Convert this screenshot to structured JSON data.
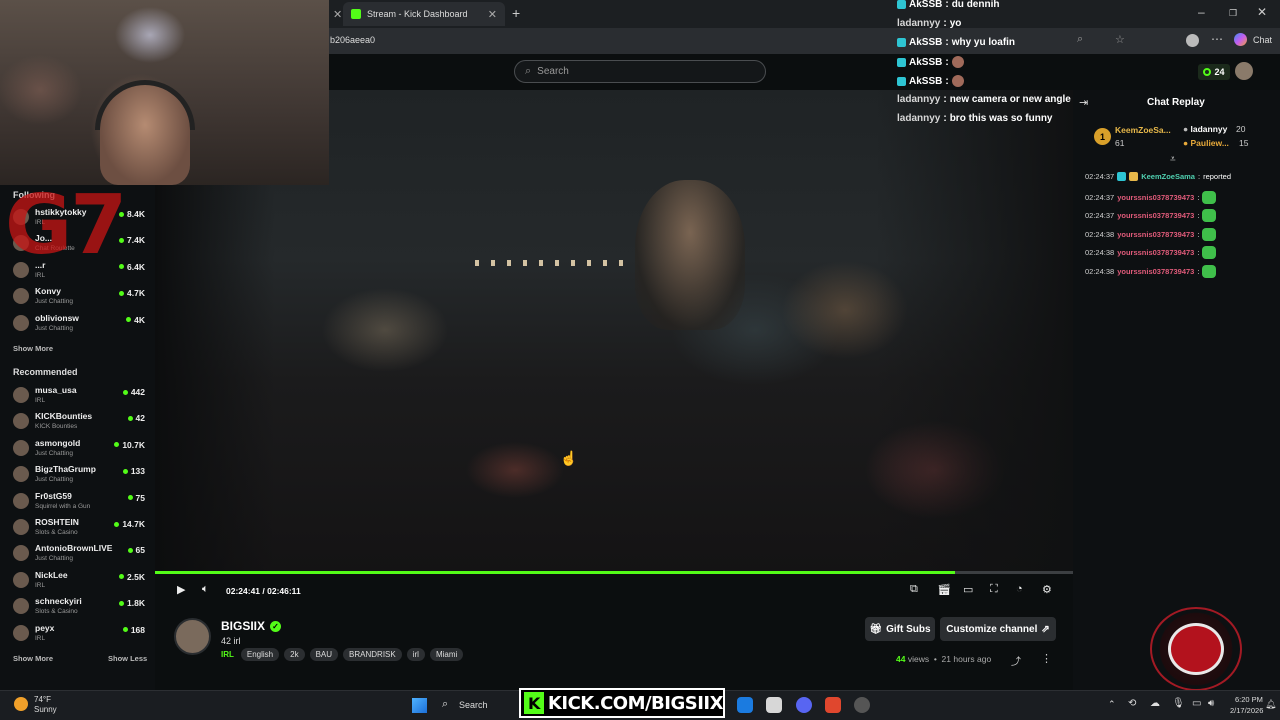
{
  "browser": {
    "tab_title": "Stream - Kick Dashboard",
    "url_fragment": "b206aeea0",
    "new_tab_symbol": "+",
    "chat_label": "Chat"
  },
  "header": {
    "search_placeholder": "Search",
    "points": "24"
  },
  "sidebar": {
    "following_label": "Following",
    "following": [
      {
        "name": "hstikkytokky",
        "category": "IRL",
        "viewers": "8.4K"
      },
      {
        "name": "Jo...",
        "category": "Chat Roulette",
        "viewers": "7.4K"
      },
      {
        "name": "...r",
        "category": "IRL",
        "viewers": "6.4K"
      },
      {
        "name": "Konvy",
        "category": "Just Chatting",
        "viewers": "4.7K"
      },
      {
        "name": "oblivionsw",
        "category": "Just Chatting",
        "viewers": "4K"
      }
    ],
    "show_more_1": "Show More",
    "recommended_label": "Recommended",
    "recommended": [
      {
        "name": "musa_usa",
        "category": "IRL",
        "viewers": "442"
      },
      {
        "name": "KICKBounties",
        "category": "KICK Bounties",
        "viewers": "42"
      },
      {
        "name": "asmongold",
        "category": "Just Chatting",
        "viewers": "10.7K"
      },
      {
        "name": "BigzThaGrump",
        "category": "Just Chatting",
        "viewers": "133"
      },
      {
        "name": "Fr0stG59",
        "category": "Squirrel with a Gun",
        "viewers": "75"
      },
      {
        "name": "ROSHTEIN",
        "category": "Slots & Casino",
        "viewers": "14.7K"
      },
      {
        "name": "AntonioBrownLIVE",
        "category": "Just Chatting",
        "viewers": "65"
      },
      {
        "name": "NickLee",
        "category": "IRL",
        "viewers": "2.5K"
      },
      {
        "name": "schneckyiri",
        "category": "Slots & Casino",
        "viewers": "1.8K"
      },
      {
        "name": "peyx",
        "category": "IRL",
        "viewers": "168"
      }
    ],
    "show_more_2": "Show More",
    "show_less": "Show Less"
  },
  "overlay": {
    "watermark": "G7",
    "chat": [
      {
        "user": "AkSSB",
        "msg": "du dennih",
        "badge": true
      },
      {
        "user": "ladannyy",
        "msg": "yo",
        "badge": false
      },
      {
        "user": "AkSSB",
        "msg": "why yu loafin",
        "badge": true
      },
      {
        "user": "AkSSB",
        "msg": "",
        "badge": true
      },
      {
        "user": "AkSSB",
        "msg": "",
        "badge": true
      },
      {
        "user": "ladannyy",
        "msg": "new camera or new angle",
        "badge": false
      },
      {
        "user": "ladannyy",
        "msg": "bro this was so funny",
        "badge": false
      }
    ]
  },
  "player": {
    "time": "02:24:41 / 02:46:11",
    "progress": 0.871
  },
  "stream": {
    "streamer": "BIGSIIX",
    "title": "42 irl",
    "category": "IRL",
    "tags": [
      "English",
      "2k",
      "BAU",
      "BRANDRISK",
      "irl",
      "Miami"
    ],
    "gift_subs": "Gift Subs",
    "customize": "Customize channel",
    "views_count": "44",
    "views_label": "views",
    "ago": "21 hours ago"
  },
  "chat_replay": {
    "title": "Chat Replay",
    "pinned": [
      {
        "rank": "1",
        "user": "KeemZoeSa...",
        "count": "61"
      },
      {
        "user": "ladannyy",
        "count": "20"
      },
      {
        "user": "Pauliew...",
        "count": "15"
      }
    ],
    "messages": [
      {
        "time": "02:24:37",
        "user": "KeemZoeSama",
        "text": "reported"
      },
      {
        "time": "02:24:37",
        "user": "yourssnis0378739473",
        "text": ""
      },
      {
        "time": "02:24:37",
        "user": "yourssnis0378739473",
        "text": ""
      },
      {
        "time": "02:24:38",
        "user": "yourssnis0378739473",
        "text": ""
      },
      {
        "time": "02:24:38",
        "user": "yourssnis0378739473",
        "text": ""
      },
      {
        "time": "02:24:38",
        "user": "yourssnis0378739473",
        "text": ""
      }
    ]
  },
  "taskbar": {
    "temp": "74°F",
    "weather": "Sunny",
    "search": "Search",
    "kick_url": "KICK.COM/BIGSIIX",
    "time": "6:20 PM",
    "date": "2/17/2026"
  },
  "colors": {
    "accent": "#53fc18",
    "username_pink": "#e05b7a",
    "watermark_red": "#c81414"
  }
}
